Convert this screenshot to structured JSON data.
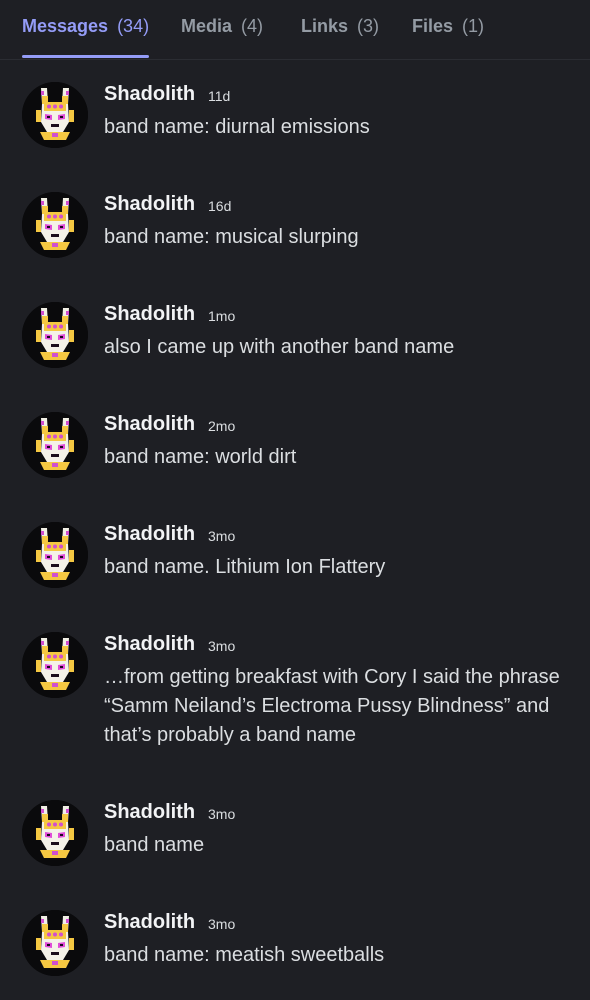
{
  "tabs": [
    {
      "label": "Messages",
      "count": "(34)"
    },
    {
      "label": "Media",
      "count": "(4)"
    },
    {
      "label": "Links",
      "count": "(3)"
    },
    {
      "label": "Files",
      "count": "(1)"
    }
  ],
  "messages": [
    {
      "author": "Shadolith",
      "time": "11d",
      "text": "band name: diurnal emissions"
    },
    {
      "author": "Shadolith",
      "time": "16d",
      "text": "band name: musical slurping"
    },
    {
      "author": "Shadolith",
      "time": "1mo",
      "text": "also I came up with another band name"
    },
    {
      "author": "Shadolith",
      "time": "2mo",
      "text": "band name: world dirt"
    },
    {
      "author": "Shadolith",
      "time": "3mo",
      "text": "band name. Lithium Ion Flattery"
    },
    {
      "author": "Shadolith",
      "time": "3mo",
      "text": "…from getting breakfast with Cory I said the phrase “Samm Neiland’s Electroma Pussy Blindness” and that’s probably a band name"
    },
    {
      "author": "Shadolith",
      "time": "3mo",
      "text": "band name"
    },
    {
      "author": "Shadolith",
      "time": "3mo",
      "text": "band name: meatish sweetballs"
    }
  ],
  "colors": {
    "background": "#1e1f24",
    "accent": "#949cf7",
    "muted": "#949ba4"
  }
}
